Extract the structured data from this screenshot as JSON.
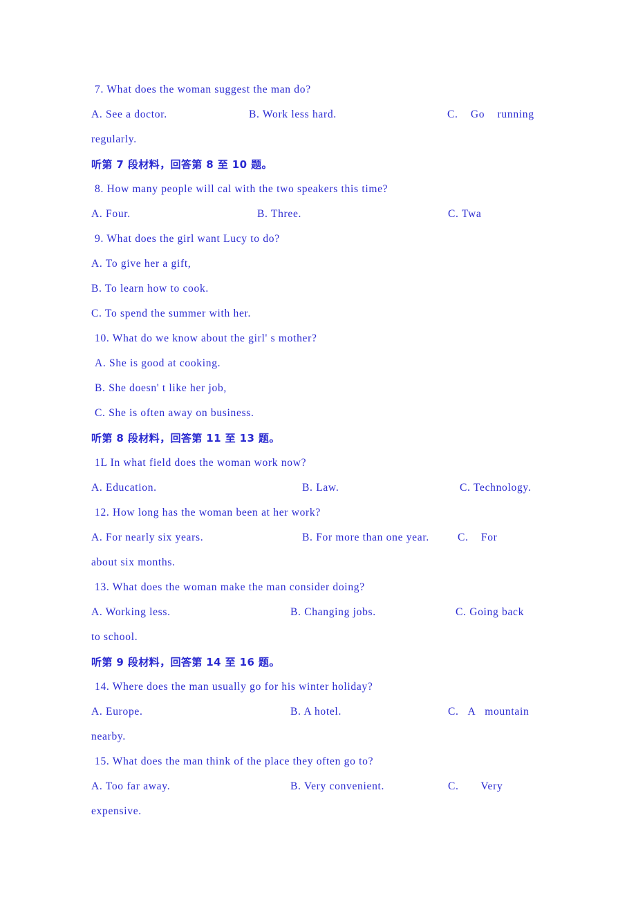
{
  "document": {
    "type": "listening-comprehension-exam-page",
    "text_color": "#2a2ad0",
    "background_color": "#ffffff",
    "lines": [
      {
        "id": "q7",
        "kind": "question",
        "text": "7. What does the woman suggest the man do?"
      },
      {
        "id": "q7opts",
        "kind": "options",
        "a": "A. See a doctor.",
        "b": "B. Work less hard.",
        "c": "C.    Go    running"
      },
      {
        "id": "q7cont",
        "kind": "continuation",
        "text": "regularly."
      },
      {
        "id": "cn7",
        "kind": "cn-heading",
        "text": "听第 7 段材料，回答第 8 至 10 题。"
      },
      {
        "id": "q8",
        "kind": "question",
        "text": "8. How many people will cal with the two speakers this time?"
      },
      {
        "id": "q8opts",
        "kind": "options",
        "a": "A. Four.",
        "b": "B. Three.",
        "c": "C. Twa"
      },
      {
        "id": "q9",
        "kind": "question",
        "text": "9. What does the girl want Lucy to do?"
      },
      {
        "id": "q9a",
        "kind": "option-line",
        "text": "A. To give her a gift,"
      },
      {
        "id": "q9b",
        "kind": "option-line",
        "text": "B. To learn how to cook."
      },
      {
        "id": "q9c",
        "kind": "option-line",
        "text": "C. To spend the summer with her."
      },
      {
        "id": "q10",
        "kind": "question",
        "text": "10. What do we know about the girl' s mother?"
      },
      {
        "id": "q10a",
        "kind": "option-line",
        "text": "A. She is good at cooking."
      },
      {
        "id": "q10b",
        "kind": "option-line",
        "text": "B. She doesn' t like her job,"
      },
      {
        "id": "q10c",
        "kind": "option-line",
        "text": "C. She is often away on business."
      },
      {
        "id": "cn8",
        "kind": "cn-heading",
        "text": "听第 8 段材料，回答第 11 至 13 题。"
      },
      {
        "id": "q11",
        "kind": "question",
        "text": "1L In what field does the woman work now?"
      },
      {
        "id": "q11opts",
        "kind": "options",
        "a": "A. Education.",
        "b": "B. Law.",
        "c": "C. Technology."
      },
      {
        "id": "q12",
        "kind": "question",
        "text": "12. How long has the woman been at her work?"
      },
      {
        "id": "q12opts",
        "kind": "options",
        "a": "A. For nearly six years.",
        "b": "B. For more than one year.",
        "c": "C.    For"
      },
      {
        "id": "q12cont",
        "kind": "continuation",
        "text": "about six months."
      },
      {
        "id": "q13",
        "kind": "question",
        "text": "13. What does the woman make the man consider doing?"
      },
      {
        "id": "q13opts",
        "kind": "options",
        "a": "A. Working less.",
        "b": "B. Changing jobs.",
        "c": "C. Going back"
      },
      {
        "id": "q13cont",
        "kind": "continuation",
        "text": "to school."
      },
      {
        "id": "cn9",
        "kind": "cn-heading",
        "text": "听第 9 段材料，回答第 14 至 16 题。"
      },
      {
        "id": "q14",
        "kind": "question",
        "text": "14. Where does the man usually go for his winter holiday?"
      },
      {
        "id": "q14opts",
        "kind": "options",
        "a": "A. Europe.",
        "b": "B. A hotel.",
        "c": "C.   A   mountain"
      },
      {
        "id": "q14cont",
        "kind": "continuation",
        "text": "nearby."
      },
      {
        "id": "q15",
        "kind": "question",
        "text": "15. What does the man think of the place they often go to?"
      },
      {
        "id": "q15opts",
        "kind": "options",
        "a": "A. Too far away.",
        "b": "B. Very convenient.",
        "c": "C.       Very"
      },
      {
        "id": "q15cont",
        "kind": "continuation",
        "text": "expensive."
      }
    ]
  }
}
